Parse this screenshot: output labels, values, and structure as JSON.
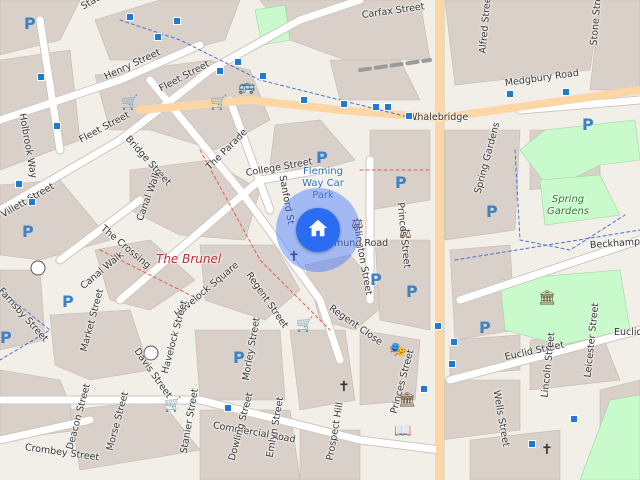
{
  "map": {
    "streets": {
      "station": "Statio",
      "carfax": "Carfax Street",
      "alfred": "Alfred Street",
      "stone": "Stone Street",
      "medgbury": "Medgbury Road",
      "henry": "Henry Street",
      "fleet_upper": "Fleet Street",
      "fleet_lower": "Fleet Street",
      "holbrook": "Holbrook Way",
      "whalebridge": "Whalebridge",
      "bridge": "Bridge Street",
      "parade": "The Parade",
      "college": "College Street",
      "islington": "Islington Street",
      "princes": "Princes Street",
      "princes_lower": "Princes Street",
      "spring_gardens": "Spring Gardens",
      "beckhampton": "Beckhampton",
      "villett": "Villett Street",
      "crossing": "The Crossing",
      "canal_walk_1": "Canal Walk",
      "canal_walk_2": "Canal Walk",
      "farnsby": "Farnsby Street",
      "havelock_sq": "Havelock Square",
      "regent": "Regent Street",
      "regent_close": "Regent Close",
      "sanford": "Sanford St",
      "edmund": "Edmund Road",
      "euclid_1": "Euclid",
      "euclid_2": "Euclid Street",
      "leicester": "Leicester Street",
      "lincoln": "Lincoln Street",
      "wells": "Wells Street",
      "davis": "Davis Street",
      "market": "Market Street",
      "havelock_st": "Havelock Street",
      "morley": "Morley Street",
      "commercial": "Commercial Road",
      "crombey": "Crombey Street",
      "deacon": "Deacon Street",
      "morse": "Morse Street",
      "stanier": "Stanier Street",
      "dowling": "Dowling Street",
      "emlyn": "Emlyn Street",
      "prospect": "Prospect Hill"
    },
    "places": {
      "car_park": "Fleming Way Car Park",
      "brunel": "The Brunel",
      "spring_gardens_park": "Spring Gardens"
    },
    "parking_glyph": "P",
    "location_marker_icon": "home-icon",
    "colors": {
      "background": "#f2efe9",
      "building": "#d9d0c9",
      "road": "#ffffff",
      "road_casing": "#cfc6bd",
      "primary_road": "#fcd6a4",
      "park": "#c8facc",
      "rail": "#9a9a9a",
      "bus_stop": "#1f7ad2",
      "parking_text": "#3c82c4",
      "location_blue": "#2a6cf2",
      "brunel_red": "#c22e2e"
    }
  }
}
